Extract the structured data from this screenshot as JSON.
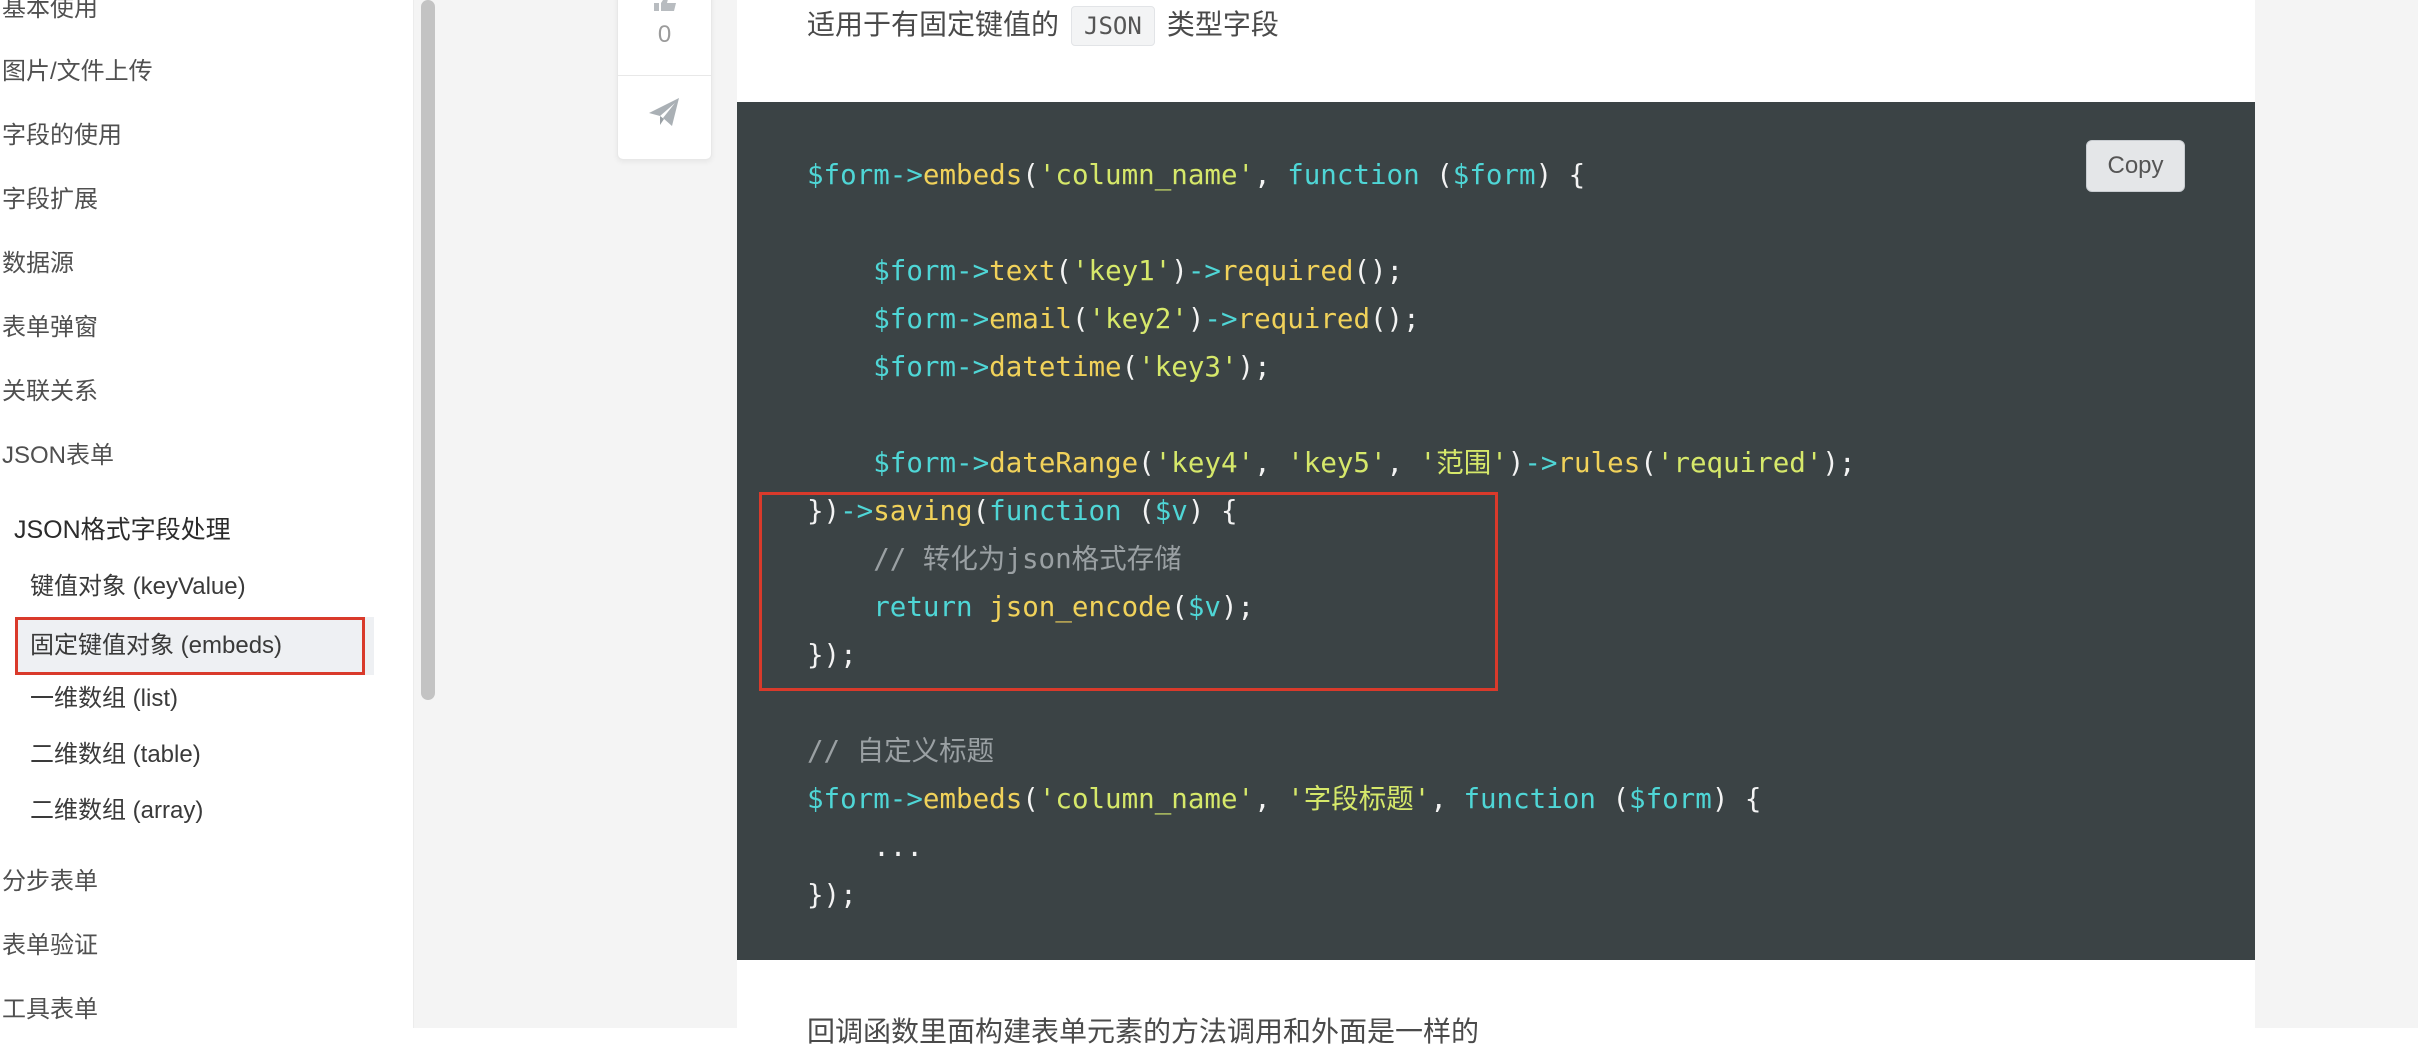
{
  "sidebar": {
    "items": [
      {
        "label": "基本使用"
      },
      {
        "label": "图片/文件上传"
      },
      {
        "label": "字段的使用"
      },
      {
        "label": "字段扩展"
      },
      {
        "label": "数据源"
      },
      {
        "label": "表单弹窗"
      },
      {
        "label": "关联关系"
      },
      {
        "label": "JSON表单"
      }
    ],
    "sub_header": "JSON格式字段处理",
    "sub_items": [
      {
        "label": "键值对象 (keyValue)"
      },
      {
        "label": "固定键值对象 (embeds)",
        "active": true
      },
      {
        "label": "一维数组 (list)"
      },
      {
        "label": "二维数组 (table)"
      },
      {
        "label": "二维数组 (array)"
      }
    ],
    "items_after": [
      {
        "label": "分步表单"
      },
      {
        "label": "表单验证"
      },
      {
        "label": "工具表单"
      }
    ]
  },
  "action_card": {
    "like_count": "0",
    "like_icon": "thumbs-up-icon",
    "share_icon": "paper-plane-icon"
  },
  "content": {
    "intro_prefix": "适用于有固定键值的",
    "intro_code": "JSON",
    "intro_suffix": "类型字段",
    "copy_label": "Copy",
    "code": {
      "l1_var": "$form",
      "l1_arrow": "->",
      "l1_method": "embeds",
      "l1_str": "'column_name'",
      "l1_kw": "function",
      "l1_param": "$form",
      "l3_var": "$form",
      "l3_a1": "->",
      "l3_m1": "text",
      "l3_str": "'key1'",
      "l3_a2": "->",
      "l3_m2": "required",
      "l4_var": "$form",
      "l4_a1": "->",
      "l4_m1": "email",
      "l4_str": "'key2'",
      "l4_a2": "->",
      "l4_m2": "required",
      "l5_var": "$form",
      "l5_a1": "->",
      "l5_m1": "datetime",
      "l5_str": "'key3'",
      "l7_var": "$form",
      "l7_a1": "->",
      "l7_m1": "dateRange",
      "l7_s1": "'key4'",
      "l7_s2": "'key5'",
      "l7_s3": "'范围'",
      "l7_a2": "->",
      "l7_m2": "rules",
      "l7_s4": "'required'",
      "l8_arrow": "->",
      "l8_method": "saving",
      "l8_kw": "function",
      "l8_param": "$v",
      "l9_comment": "// 转化为json格式存储",
      "l10_kw": "return",
      "l10_func": "json_encode",
      "l10_param": "$v",
      "l13_comment": "// 自定义标题",
      "l14_var": "$form",
      "l14_arrow": "->",
      "l14_method": "embeds",
      "l14_s1": "'column_name'",
      "l14_s2": "'字段标题'",
      "l14_kw": "function",
      "l14_param": "$form",
      "l15_ellipsis": "..."
    },
    "bottom_text": "回调函数里面构建表单元素的方法调用和外面是一样的"
  }
}
